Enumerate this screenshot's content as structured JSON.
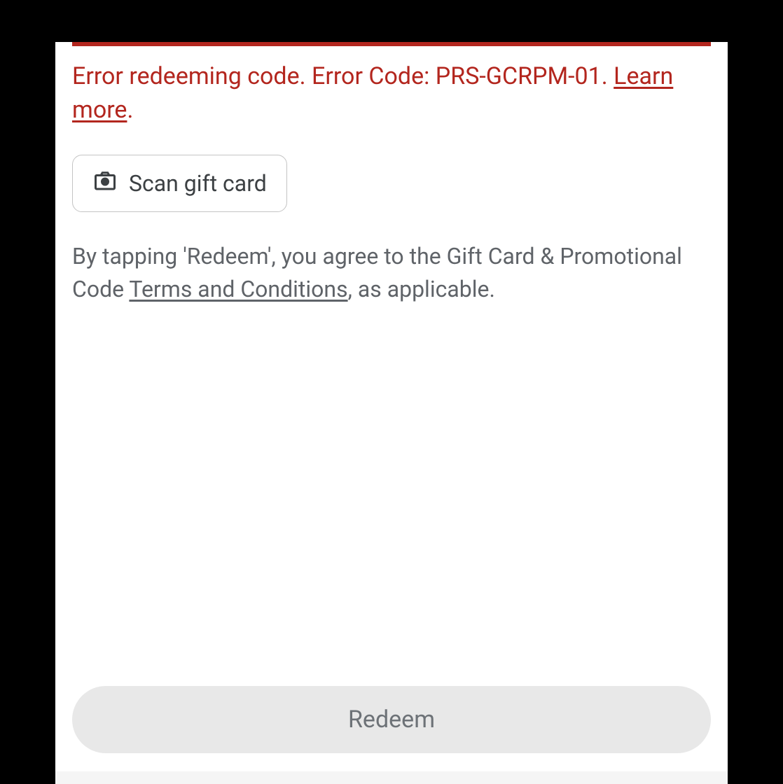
{
  "error": {
    "message_prefix": "Error redeeming code. Error Code: PRS-GCRPM-01. ",
    "learn_more": "Learn more",
    "suffix": "."
  },
  "scan_button": {
    "label": "Scan gift card"
  },
  "terms": {
    "prefix": "By tapping 'Redeem', you agree to the Gift Card & Promotional Code ",
    "link": "Terms and Conditions",
    "suffix": ", as applicable."
  },
  "redeem_button": {
    "label": "Redeem"
  }
}
